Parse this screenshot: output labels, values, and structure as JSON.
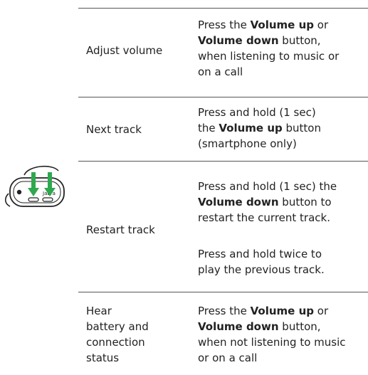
{
  "rows": [
    {
      "action": [
        "Adjust volume"
      ],
      "paragraphs": [
        [
          [
            {
              "t": "Press the "
            },
            {
              "b": "Volume up"
            },
            {
              "t": " or"
            }
          ],
          [
            {
              "b": "Volume down"
            },
            {
              "t": " button,"
            }
          ],
          [
            {
              "t": "when listening to music or"
            }
          ],
          [
            {
              "t": "on a call"
            }
          ]
        ]
      ]
    },
    {
      "action": [
        "Next track"
      ],
      "paragraphs": [
        [
          [
            {
              "t": "Press and hold (1 sec)"
            }
          ],
          [
            {
              "t": "the "
            },
            {
              "b": "Volume up"
            },
            {
              "t": " button"
            }
          ],
          [
            {
              "t": "(smartphone only)"
            }
          ]
        ]
      ]
    },
    {
      "action": [
        "Restart track"
      ],
      "paragraphs": [
        [
          [
            {
              "t": "Press and hold (1 sec) the"
            }
          ],
          [
            {
              "b": "Volume down"
            },
            {
              "t": " button to"
            }
          ],
          [
            {
              "t": "restart the current track."
            }
          ]
        ],
        [
          [
            {
              "t": "Press and hold twice to"
            }
          ],
          [
            {
              "t": "play the previous track."
            }
          ]
        ]
      ]
    },
    {
      "action": [
        "Hear",
        "battery and",
        "connection",
        "status"
      ],
      "paragraphs": [
        [
          [
            {
              "t": "Press the "
            },
            {
              "b": "Volume up"
            },
            {
              "t": " or"
            }
          ],
          [
            {
              "b": "Volume down"
            },
            {
              "t": " button,"
            }
          ],
          [
            {
              "t": "when not listening to music"
            }
          ],
          [
            {
              "t": "or on a call"
            }
          ]
        ]
      ]
    }
  ],
  "illustration": {
    "brand_text": "Jabra",
    "arrow_color": "#2fa84f",
    "icon": "earbud-volume-buttons-icon"
  }
}
